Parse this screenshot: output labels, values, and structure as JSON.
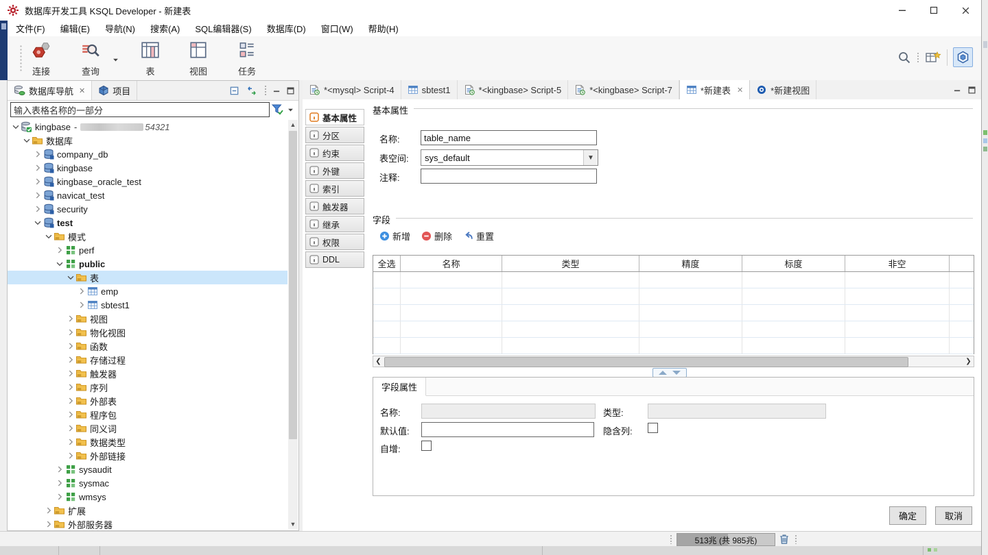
{
  "colors": {
    "selection": "#cbe6fb",
    "accent_blue": "#3d8fe0",
    "accent_red": "#e25555",
    "active_info": "#e07a1f",
    "navy_fragment": "#1d3b73"
  },
  "window": {
    "title": "数据库开发工具 KSQL Developer - 新建表",
    "controls": {
      "minimize": "minimize",
      "maximize": "maximize",
      "close": "close"
    }
  },
  "menu": {
    "items": [
      "文件(F)",
      "编辑(E)",
      "导航(N)",
      "搜索(A)",
      "SQL编辑器(S)",
      "数据库(D)",
      "窗口(W)",
      "帮助(H)"
    ]
  },
  "toolbar": {
    "items": [
      {
        "icon": "connect",
        "label": "连接",
        "dropdown": false
      },
      {
        "icon": "query",
        "label": "查询",
        "dropdown": true
      },
      {
        "icon": "table-large",
        "label": "表",
        "dropdown": false
      },
      {
        "icon": "view-large",
        "label": "视图",
        "dropdown": false
      },
      {
        "icon": "task-large",
        "label": "任务",
        "dropdown": false
      }
    ]
  },
  "artifacts": {
    "background_digit": "5"
  },
  "navigator": {
    "tabs": [
      {
        "icon": "dbnav",
        "label": "数据库导航",
        "active": true,
        "closable": true
      },
      {
        "icon": "project",
        "label": "项目",
        "active": false,
        "closable": false
      }
    ],
    "filter_value": "输入表格名称的一部分",
    "tree": [
      {
        "depth": 0,
        "chev": "open",
        "icon": "connection",
        "label": "kingbase",
        "conn": true,
        "conn_suffix": "54321"
      },
      {
        "depth": 1,
        "chev": "open",
        "icon": "folder-db",
        "label": "数据库"
      },
      {
        "depth": 2,
        "chev": "closed",
        "icon": "database",
        "label": "company_db"
      },
      {
        "depth": 2,
        "chev": "closed",
        "icon": "database",
        "label": "kingbase"
      },
      {
        "depth": 2,
        "chev": "closed",
        "icon": "database",
        "label": "kingbase_oracle_test"
      },
      {
        "depth": 2,
        "chev": "closed",
        "icon": "database",
        "label": "navicat_test"
      },
      {
        "depth": 2,
        "chev": "closed",
        "icon": "database",
        "label": "security"
      },
      {
        "depth": 2,
        "chev": "open",
        "icon": "database",
        "label": "test",
        "bold": true
      },
      {
        "depth": 3,
        "chev": "open",
        "icon": "folder-schema",
        "label": "模式"
      },
      {
        "depth": 4,
        "chev": "closed",
        "icon": "schema",
        "label": "perf"
      },
      {
        "depth": 4,
        "chev": "open",
        "icon": "schema",
        "label": "public",
        "bold": true
      },
      {
        "depth": 5,
        "chev": "open",
        "icon": "folder-table",
        "label": "表",
        "selected": true
      },
      {
        "depth": 6,
        "chev": "closed",
        "icon": "table",
        "label": "emp"
      },
      {
        "depth": 6,
        "chev": "closed",
        "icon": "table",
        "label": "sbtest1"
      },
      {
        "depth": 5,
        "chev": "closed",
        "icon": "folder-view",
        "label": "视图"
      },
      {
        "depth": 5,
        "chev": "closed",
        "icon": "folder-mview",
        "label": "物化视图"
      },
      {
        "depth": 5,
        "chev": "closed",
        "icon": "folder-function",
        "label": "函数"
      },
      {
        "depth": 5,
        "chev": "closed",
        "icon": "folder-procedure",
        "label": "存储过程"
      },
      {
        "depth": 5,
        "chev": "closed",
        "icon": "folder-trigger",
        "label": "触发器"
      },
      {
        "depth": 5,
        "chev": "closed",
        "icon": "folder-sequence",
        "label": "序列"
      },
      {
        "depth": 5,
        "chev": "closed",
        "icon": "folder-exttable",
        "label": "外部表"
      },
      {
        "depth": 5,
        "chev": "closed",
        "icon": "folder-package",
        "label": "程序包"
      },
      {
        "depth": 5,
        "chev": "closed",
        "icon": "folder-synonym",
        "label": "同义词"
      },
      {
        "depth": 5,
        "chev": "closed",
        "icon": "folder-datatype",
        "label": "数据类型"
      },
      {
        "depth": 5,
        "chev": "closed",
        "icon": "folder-dblink",
        "label": "外部链接"
      },
      {
        "depth": 4,
        "chev": "closed",
        "icon": "schema",
        "label": "sysaudit"
      },
      {
        "depth": 4,
        "chev": "closed",
        "icon": "schema",
        "label": "sysmac"
      },
      {
        "depth": 4,
        "chev": "closed",
        "icon": "schema",
        "label": "wmsys"
      },
      {
        "depth": 3,
        "chev": "closed",
        "icon": "folder-extension",
        "label": "扩展"
      },
      {
        "depth": 3,
        "chev": "closed",
        "icon": "folder-server",
        "label": "外部服务器"
      },
      {
        "depth": 2,
        "chev": "closed",
        "icon": "role",
        "label": ""
      }
    ]
  },
  "editor": {
    "tabs": [
      {
        "icon": "script",
        "label": "*<mysql> Script-4",
        "active": false
      },
      {
        "icon": "table",
        "label": "sbtest1",
        "active": false
      },
      {
        "icon": "script",
        "label": "*<kingbase> Script-5",
        "active": false
      },
      {
        "icon": "script",
        "label": "*<kingbase> Script-7",
        "active": false
      },
      {
        "icon": "table",
        "label": "*新建表",
        "active": true,
        "closable": true
      },
      {
        "icon": "view",
        "label": "*新建视图",
        "active": false
      }
    ],
    "side_tabs": [
      {
        "label": "基本属性",
        "active": true
      },
      {
        "label": "分区",
        "active": false
      },
      {
        "label": "约束",
        "active": false
      },
      {
        "label": "外键",
        "active": false
      },
      {
        "label": "索引",
        "active": false
      },
      {
        "label": "触发器",
        "active": false
      },
      {
        "label": "继承",
        "active": false
      },
      {
        "label": "权限",
        "active": false
      },
      {
        "label": "DDL",
        "active": false
      }
    ],
    "basic": {
      "legend": "基本属性",
      "name_label": "名称:",
      "name_value": "table_name",
      "tablespace_label": "表空间:",
      "tablespace_value": "sys_default",
      "comment_label": "注释:",
      "comment_value": ""
    },
    "fields": {
      "legend": "字段",
      "add_label": "新增",
      "delete_label": "删除",
      "reset_label": "重置",
      "columns": [
        "全选",
        "名称",
        "类型",
        "精度",
        "标度",
        "非空"
      ]
    },
    "field_props": {
      "tab_label": "字段属性",
      "name_label": "名称:",
      "type_label": "类型:",
      "default_label": "默认值:",
      "hidden_label": "隐含列:",
      "autoincrement_label": "自增:",
      "name_value": "",
      "type_value": "",
      "default_value": "",
      "hidden_checked": false,
      "autoincrement_checked": false
    },
    "buttons": {
      "ok": "确定",
      "cancel": "取消"
    }
  },
  "statusbar": {
    "memory": "513兆 (共 985兆)"
  }
}
